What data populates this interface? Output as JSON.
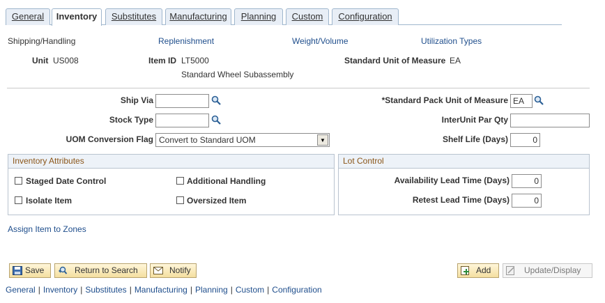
{
  "tabs": [
    {
      "label": "General"
    },
    {
      "label": "Inventory"
    },
    {
      "label": "Substitutes"
    },
    {
      "label": "Manufacturing"
    },
    {
      "label": "Planning"
    },
    {
      "label": "Custom"
    },
    {
      "label": "Configuration"
    }
  ],
  "sections": {
    "current": "Shipping/Handling",
    "replenishment": "Replenishment",
    "weight_volume": "Weight/Volume",
    "utilization_types": "Utilization Types"
  },
  "header": {
    "unit_label": "Unit",
    "unit_value": "US008",
    "item_id_label": "Item ID",
    "item_id_value": "LT5000",
    "item_description": "Standard Wheel Subassembly",
    "std_uom_label": "Standard Unit of Measure",
    "std_uom_value": "EA"
  },
  "form": {
    "ship_via_label": "Ship Via",
    "ship_via_value": "",
    "stock_type_label": "Stock Type",
    "stock_type_value": "",
    "uom_conv_label": "UOM Conversion Flag",
    "uom_conv_value": "Convert to Standard UOM",
    "std_pack_uom_label": "*Standard Pack Unit of Measure",
    "std_pack_uom_value": "EA",
    "interunit_par_label": "InterUnit Par Qty",
    "interunit_par_value": "",
    "shelf_life_label": "Shelf Life (Days)",
    "shelf_life_value": "0"
  },
  "inventory_attributes": {
    "title": "Inventory Attributes",
    "staged_date_control": "Staged Date Control",
    "additional_handling": "Additional Handling",
    "isolate_item": "Isolate Item",
    "oversized_item": "Oversized Item"
  },
  "lot_control": {
    "title": "Lot Control",
    "availability_label": "Availability Lead Time (Days)",
    "availability_value": "0",
    "retest_label": "Retest Lead Time (Days)",
    "retest_value": "0"
  },
  "assign_link": "Assign Item to Zones",
  "buttons": {
    "save": "Save",
    "return_to_search": "Return to Search",
    "notify": "Notify",
    "add": "Add",
    "update_display": "Update/Display"
  },
  "bottom_nav": [
    "General",
    "Inventory",
    "Substitutes",
    "Manufacturing",
    "Planning",
    "Custom",
    "Configuration"
  ]
}
